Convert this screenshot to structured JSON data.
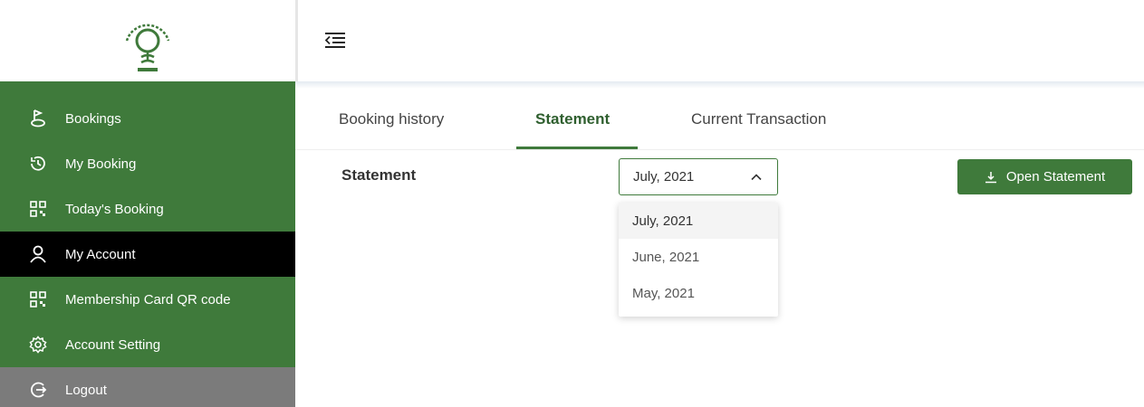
{
  "sidebar": {
    "logo_icon": "golf-ball-tee-logo-icon",
    "items": [
      {
        "label": "Bookings",
        "icon": "golf-flag-icon",
        "active": false
      },
      {
        "label": "My Booking",
        "icon": "clock-history-icon",
        "active": false
      },
      {
        "label": "Today's Booking",
        "icon": "qr-code-icon",
        "active": false
      },
      {
        "label": "My Account",
        "icon": "user-icon",
        "active": true
      },
      {
        "label": "Membership Card QR code",
        "icon": "qr-code-icon",
        "active": false
      },
      {
        "label": "Account Setting",
        "icon": "gear-icon",
        "active": false
      },
      {
        "label": "Logout",
        "icon": "logout-icon",
        "active": false
      }
    ]
  },
  "topbar": {
    "toggle_icon": "menu-collapse-icon"
  },
  "tabs": [
    {
      "label": "Booking history",
      "active": false
    },
    {
      "label": "Statement",
      "active": true
    },
    {
      "label": "Current Transaction",
      "active": false
    }
  ],
  "statement": {
    "label": "Statement",
    "selected_month": "July, 2021",
    "options": [
      "July, 2021",
      "June, 2021",
      "May, 2021"
    ],
    "open_button_label": "Open Statement",
    "open_button_icon": "download-icon"
  },
  "colors": {
    "brand_green": "#3f7a3b",
    "active_nav": "#000000",
    "logout_bg": "#7b7b7b"
  }
}
